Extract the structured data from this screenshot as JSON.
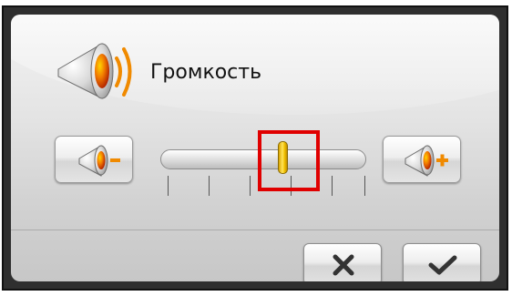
{
  "dialog": {
    "title": "Громкость",
    "title_icon": "speaker-volume-icon"
  },
  "volume": {
    "level_percent": 60,
    "tick_count": 6,
    "decrease_icon": "speaker-minus-icon",
    "increase_icon": "speaker-plus-icon"
  },
  "actions": {
    "cancel_icon": "close-icon",
    "confirm_icon": "checkmark-icon"
  },
  "colors": {
    "accent": "#f08a00",
    "thumb": "#f2c100",
    "highlight": "#e00000"
  }
}
